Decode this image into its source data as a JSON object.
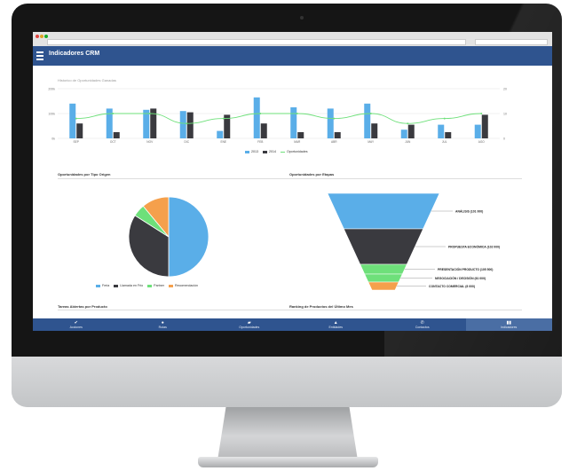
{
  "app": {
    "title": "Indicadores CRM"
  },
  "history": {
    "title": "Historico de Oportunidades Ganadas",
    "chart_data": {
      "type": "bar",
      "categories": [
        "SEP",
        "OCT",
        "NOV",
        "DIC",
        "ENE",
        "FEB",
        "MAR",
        "ABR",
        "MAY",
        "JUN",
        "JUL",
        "AGO"
      ],
      "series": [
        {
          "name": "2013",
          "values": [
            140,
            120,
            115,
            110,
            30,
            165,
            125,
            120,
            140,
            35,
            55,
            55
          ]
        },
        {
          "name": "2014",
          "values": [
            60,
            25,
            120,
            105,
            95,
            60,
            25,
            25,
            60,
            55,
            25,
            95
          ]
        },
        {
          "name": "Oportunidades",
          "values": [
            8,
            10,
            10,
            6,
            8,
            10,
            10,
            8,
            10,
            6,
            8,
            10
          ]
        }
      ],
      "y_left_ticks": [
        "0k",
        "100k",
        "200k"
      ],
      "y_right_ticks": [
        "0",
        "10",
        "20"
      ],
      "ylim": [
        0,
        200
      ],
      "y2lim": [
        0,
        20
      ]
    }
  },
  "origin": {
    "title": "Oportunidades por Tipo Origen",
    "chart_data": {
      "type": "pie",
      "labels": [
        "Feria",
        "Llamada en Frio",
        "Partner",
        "Recomendación"
      ],
      "values": [
        50,
        34,
        5,
        11
      ]
    }
  },
  "stages": {
    "title": "Oportunidades por Etapas",
    "chart_data": {
      "type": "funnel",
      "labels": [
        "ANÁLISIS (101 000)",
        "PROPUESTA ECONÓMICA (102 000)",
        "PRESENTACIÓN PRODUCTO (105 500)",
        "NEGOCIACIÓN / DECISIÓN (61 000)",
        "CONTACTO COMERCIAL (8 000)"
      ],
      "values": [
        101000,
        102000,
        105500,
        61000,
        8000
      ]
    }
  },
  "tasks": {
    "title": "Tareas Abiertas por Producto"
  },
  "ranking": {
    "title": "Ranking de Productos del Último Mes"
  },
  "nav": [
    {
      "label": "Acciones",
      "icon": "check-icon"
    },
    {
      "label": "Rutas",
      "icon": "globe-icon"
    },
    {
      "label": "Oportunidades",
      "icon": "chat-icon"
    },
    {
      "label": "Entidades",
      "icon": "user-icon"
    },
    {
      "label": "Contactos",
      "icon": "phone-icon"
    },
    {
      "label": "Indicadores",
      "icon": "bar-chart-icon"
    }
  ],
  "colors": {
    "blue": "#5aaee8",
    "dark": "#3a3a3f",
    "green": "#6ee07a",
    "orange": "#f5a04c",
    "appbar": "#2f548f"
  }
}
